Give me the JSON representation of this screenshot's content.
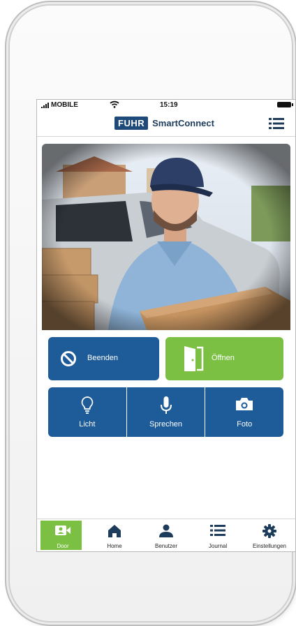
{
  "status_bar": {
    "carrier": "MOBILE",
    "time": "15:19"
  },
  "header": {
    "logo": "FUHR",
    "app_name": "SmartConnect",
    "menu_icon": "list-icon"
  },
  "camera": {
    "description": "door-camera-feed"
  },
  "buttons": {
    "end_label": "Beenden",
    "open_label": "Öffnen"
  },
  "actions": [
    {
      "label": "Licht",
      "icon": "lightbulb-icon"
    },
    {
      "label": "Sprechen",
      "icon": "microphone-icon"
    },
    {
      "label": "Foto",
      "icon": "camera-icon"
    }
  ],
  "tabs": [
    {
      "label": "Door",
      "icon": "video-user-icon",
      "active": true
    },
    {
      "label": "Home",
      "icon": "home-icon",
      "active": false
    },
    {
      "label": "Benutzer",
      "icon": "user-icon",
      "active": false
    },
    {
      "label": "Journal",
      "icon": "list-icon",
      "active": false
    },
    {
      "label": "Einstellungen",
      "icon": "gear-icon",
      "active": false
    }
  ],
  "colors": {
    "brand_blue": "#1d5b99",
    "accent_green": "#7bc043",
    "logo_blue": "#1d4a79"
  }
}
